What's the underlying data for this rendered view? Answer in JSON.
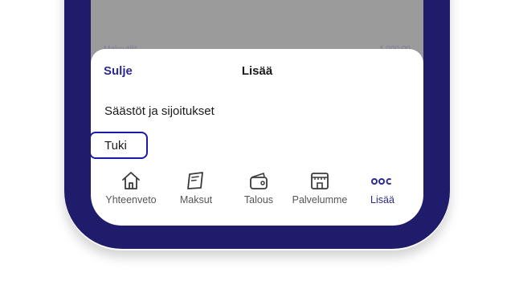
{
  "background_hint": {
    "left_text": "Maksutilit",
    "right_text": "1 000,00"
  },
  "sheet": {
    "close_label": "Sulje",
    "title": "Lisää",
    "items": [
      {
        "label": "Säästöt ja sijoitukset",
        "focused": false
      },
      {
        "label": "Tuki",
        "focused": true
      }
    ]
  },
  "tabbar": {
    "tabs": [
      {
        "label": "Yhteenveto",
        "icon": "home-icon",
        "active": false
      },
      {
        "label": "Maksut",
        "icon": "payments-icon",
        "active": false
      },
      {
        "label": "Talous",
        "icon": "wallet-icon",
        "active": false
      },
      {
        "label": "Palvelumme",
        "icon": "store-icon",
        "active": false
      },
      {
        "label": "Lisää",
        "icon": "more-dots-icon",
        "active": true
      }
    ]
  },
  "colors": {
    "frame": "#1f1c6b",
    "accent": "#2b2a8f",
    "focus_outline": "#1a1aa8",
    "active_underline": "#9ec6e6",
    "overlay": "#9b9b9b"
  }
}
